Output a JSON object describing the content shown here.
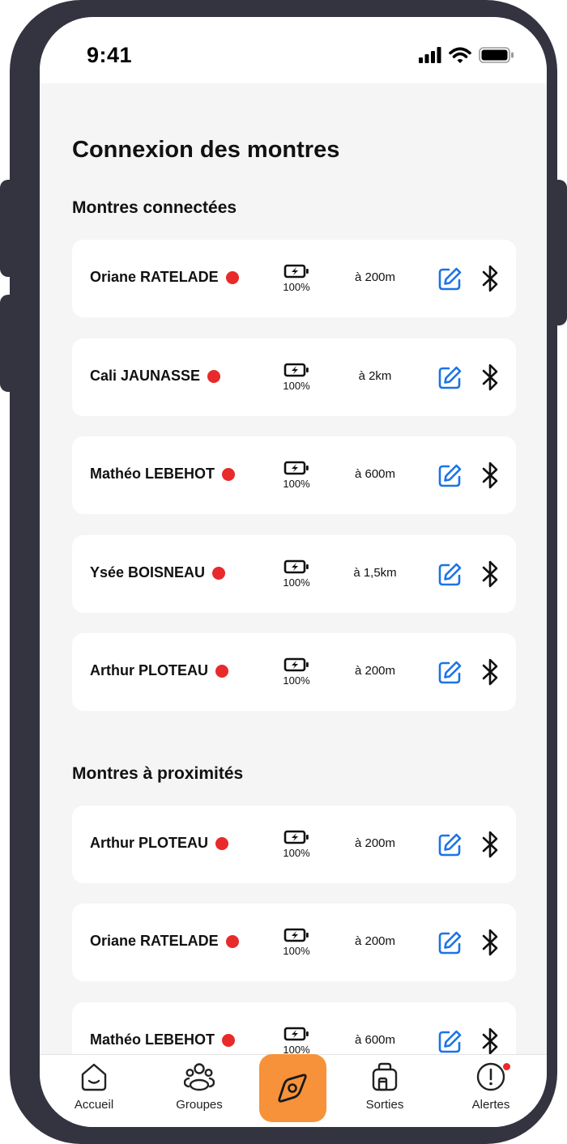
{
  "status_bar": {
    "time": "9:41"
  },
  "page": {
    "title": "Connexion des montres"
  },
  "sections": {
    "connected": {
      "title": "Montres connectées",
      "items": [
        {
          "name": "Oriane RATELADE",
          "battery": "100%",
          "distance": "à 200m"
        },
        {
          "name": "Cali JAUNASSE",
          "battery": "100%",
          "distance": "à 2km"
        },
        {
          "name": "Mathéo LEBEHOT",
          "battery": "100%",
          "distance": "à 600m"
        },
        {
          "name": "Ysée BOISNEAU",
          "battery": "100%",
          "distance": "à 1,5km"
        },
        {
          "name": "Arthur PLOTEAU",
          "battery": "100%",
          "distance": "à 200m"
        }
      ]
    },
    "nearby": {
      "title": "Montres à proximités",
      "items": [
        {
          "name": "Arthur PLOTEAU",
          "battery": "100%",
          "distance": "à 200m"
        },
        {
          "name": "Oriane RATELADE",
          "battery": "100%",
          "distance": "à 200m"
        },
        {
          "name": "Mathéo LEBEHOT",
          "battery": "100%",
          "distance": "à 600m"
        }
      ]
    }
  },
  "tabbar": {
    "tabs": [
      {
        "label": "Accueil",
        "icon": "home-icon"
      },
      {
        "label": "Groupes",
        "icon": "groups-icon"
      },
      {
        "label": "",
        "icon": "compass-icon",
        "active": true
      },
      {
        "label": "Sorties",
        "icon": "luggage-icon"
      },
      {
        "label": "Alertes",
        "icon": "alert-icon"
      }
    ]
  },
  "colors": {
    "accent": "#f7923a",
    "edit_icon": "#1a73e8",
    "status_dot": "#e82a2a",
    "frame": "#343340",
    "background": "#f5f5f5"
  }
}
